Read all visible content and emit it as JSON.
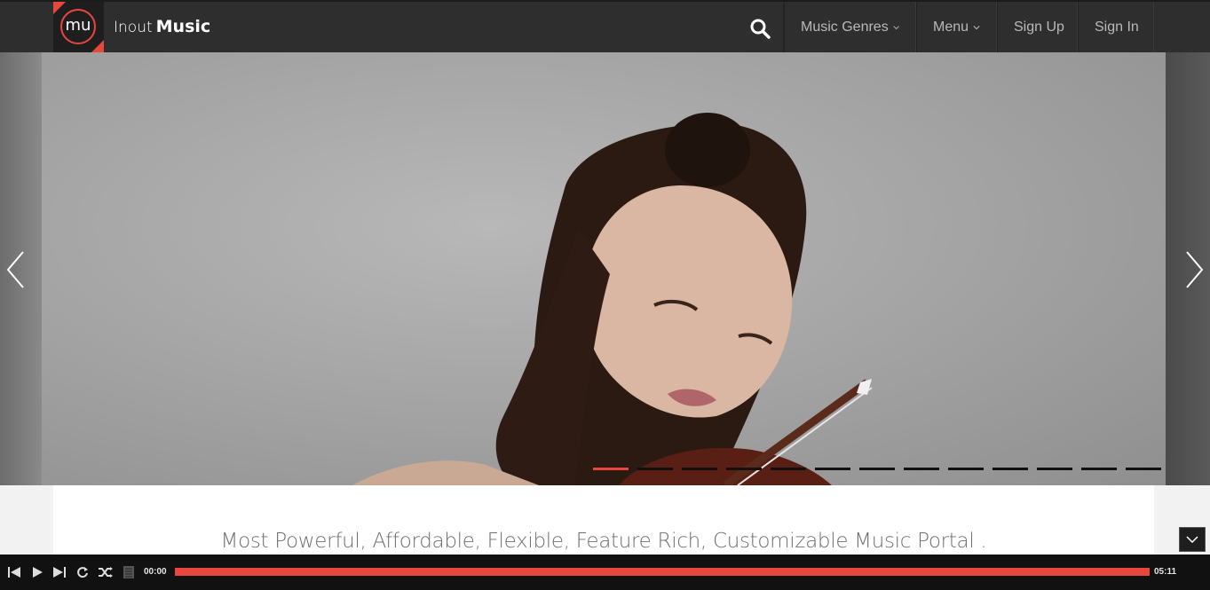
{
  "header": {
    "logo_text": "mu",
    "brand_light": "Inout",
    "brand_bold": "Music",
    "nav": [
      {
        "label": "Music Genres",
        "has_dropdown": true
      },
      {
        "label": "Menu",
        "has_dropdown": true
      },
      {
        "label": "Sign Up",
        "has_dropdown": false
      },
      {
        "label": "Sign In",
        "has_dropdown": false
      }
    ]
  },
  "slider": {
    "slide_count": 13,
    "active_slide": 1
  },
  "content": {
    "tagline": "Most Powerful, Affordable, Flexible, Feature Rich, Customizable Music Portal ."
  },
  "player": {
    "current_time": "00:00",
    "total_time": "05:11",
    "progress": 1.0
  },
  "colors": {
    "accent": "#e8473e",
    "topbar": "#2e2e2e",
    "player": "#111111"
  }
}
